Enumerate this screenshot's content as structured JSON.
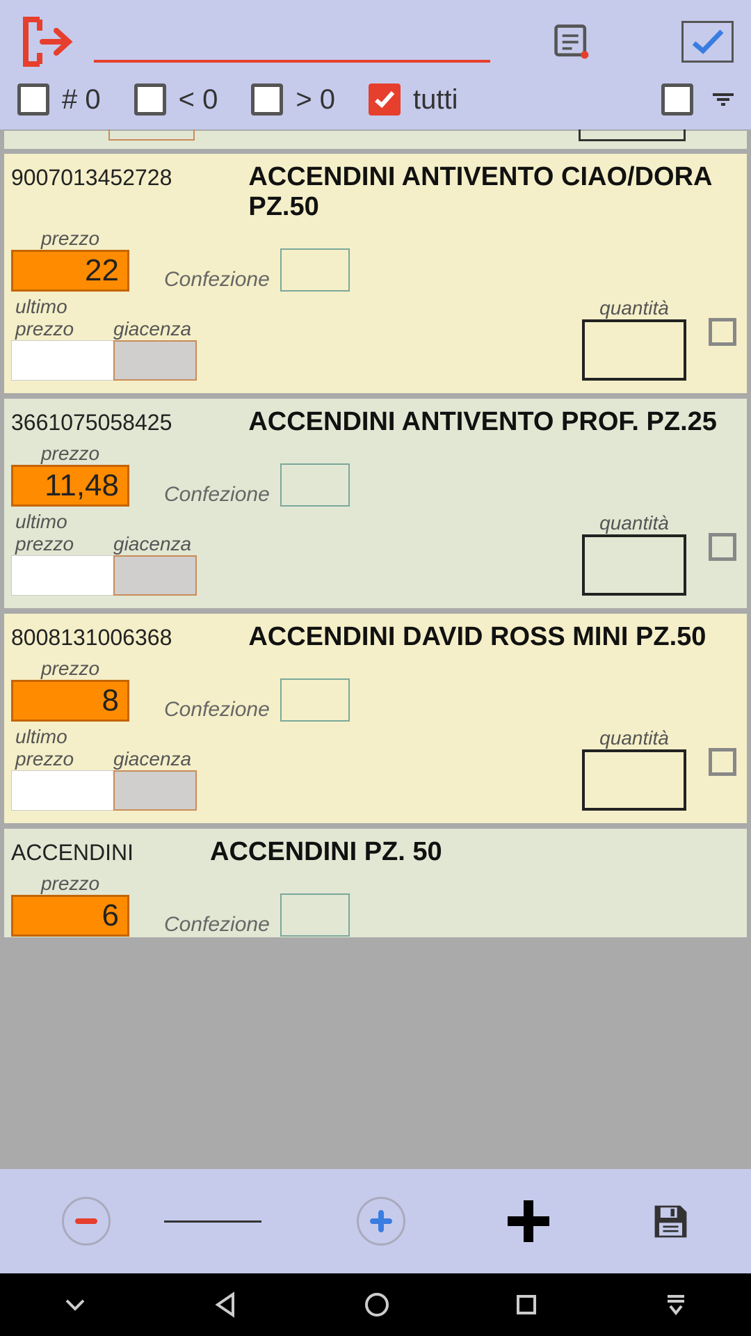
{
  "filters": {
    "zero": "# 0",
    "less": "< 0",
    "greater": "> 0",
    "all": "tutti"
  },
  "labels": {
    "prezzo": "prezzo",
    "confezione": "Confezione",
    "quantita": "quantità",
    "ultimo_prezzo": "ultimo prezzo",
    "giacenza": "giacenza"
  },
  "items": [
    {
      "barcode": "9007013452728",
      "name": "ACCENDINI ANTIVENTO CIAO/DORA PZ.50",
      "price": "22",
      "alt": false
    },
    {
      "barcode": "3661075058425",
      "name": "ACCENDINI ANTIVENTO PROF. PZ.25",
      "price": "11,48",
      "alt": true
    },
    {
      "barcode": "8008131006368",
      "name": "ACCENDINI DAVID ROSS MINI PZ.50",
      "price": "8",
      "alt": false
    },
    {
      "barcode": "ACCENDINI",
      "name": "ACCENDINI PZ. 50",
      "price": "6",
      "alt": true
    }
  ]
}
